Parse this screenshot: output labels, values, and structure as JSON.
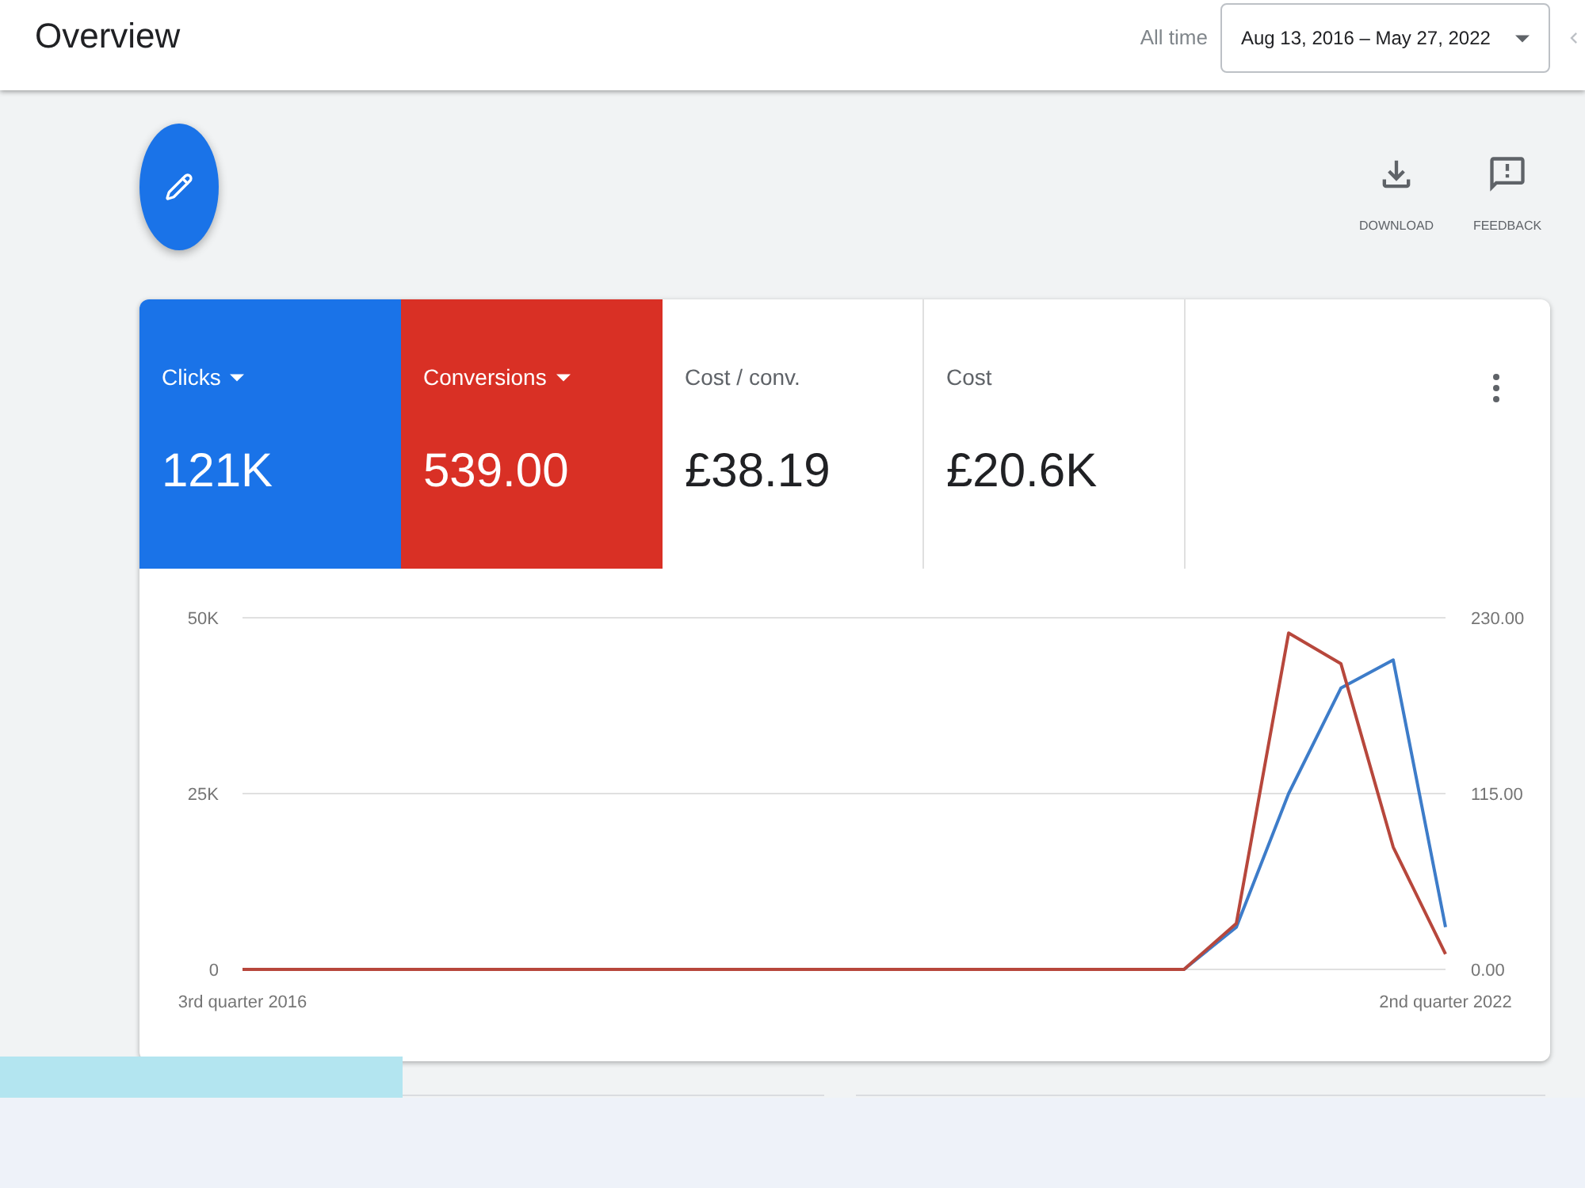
{
  "header": {
    "title": "Overview",
    "date_preset": "All time",
    "date_range": "Aug 13, 2016 – May 27, 2022"
  },
  "toolbar": {
    "actions": [
      {
        "kind": "download",
        "label": "DOWNLOAD"
      },
      {
        "kind": "feedback",
        "label": "FEEDBACK"
      }
    ]
  },
  "metrics": [
    {
      "label": "Clicks",
      "value": "121K",
      "selected": true,
      "color": "#1a73e8"
    },
    {
      "label": "Conversions",
      "value": "539.00",
      "selected": true,
      "color": "#d93025"
    },
    {
      "label": "Cost / conv.",
      "value": "£38.19",
      "selected": false
    },
    {
      "label": "Cost",
      "value": "£20.6K",
      "selected": false
    }
  ],
  "chart": {
    "chart_data": {
      "type": "line",
      "categories": [
        "3rd quarter 2016",
        null,
        null,
        null,
        null,
        null,
        null,
        null,
        null,
        null,
        null,
        null,
        null,
        null,
        null,
        null,
        null,
        null,
        null,
        null,
        null,
        null,
        null,
        "2nd quarter 2022"
      ],
      "ylim": [
        0,
        50000
      ],
      "yticks": [
        {
          "value": 0,
          "label": "0"
        },
        {
          "value": 25000,
          "label": "25K"
        },
        {
          "value": 50000,
          "label": "50K"
        }
      ],
      "y2lim": [
        0,
        230
      ],
      "y2ticks": [
        {
          "value": 0,
          "label": "0.00"
        },
        {
          "value": 115,
          "label": "115.00"
        },
        {
          "value": 230,
          "label": "230.00"
        }
      ],
      "series": [
        {
          "color": "#3d7cc9",
          "values": [
            null,
            null,
            null,
            null,
            null,
            null,
            null,
            null,
            null,
            null,
            null,
            null,
            null,
            null,
            null,
            null,
            null,
            null,
            0,
            6000,
            25000,
            40000,
            44000,
            6000
          ]
        },
        {
          "color": "#b7473c",
          "axis": "y2",
          "values": [
            0,
            0,
            0,
            0,
            0,
            0,
            0,
            0,
            0,
            0,
            0,
            0,
            0,
            0,
            0,
            0,
            0,
            0,
            0,
            30,
            220,
            200,
            80,
            10
          ]
        }
      ]
    }
  }
}
